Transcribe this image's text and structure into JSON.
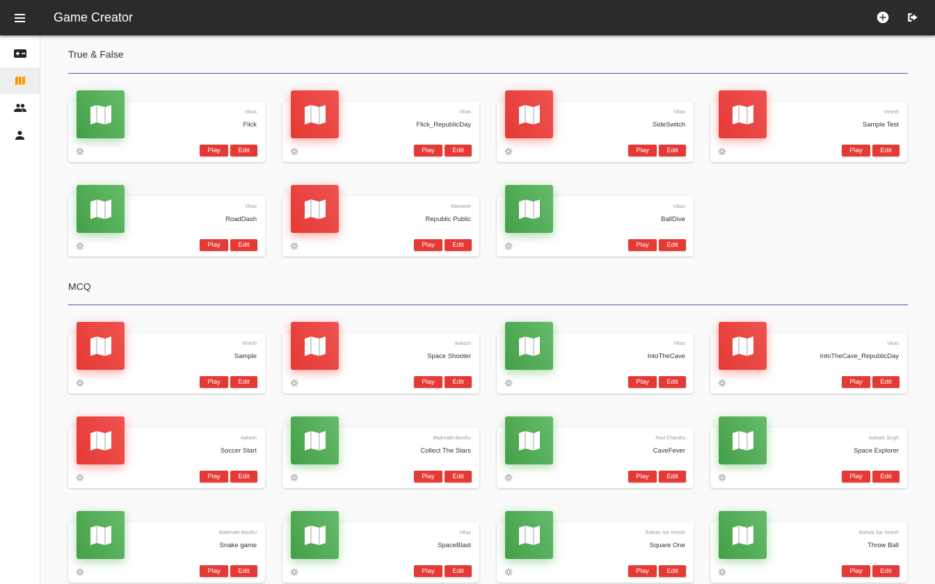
{
  "header": {
    "title": "Game Creator"
  },
  "sections": [
    {
      "title": "True & False",
      "games": [
        {
          "author": "Vikas",
          "name": "Flick",
          "thumb": "green"
        },
        {
          "author": "Vikas",
          "name": "Flick_RepublicDay",
          "thumb": "red"
        },
        {
          "author": "Vikas",
          "name": "SideSwitch",
          "thumb": "red"
        },
        {
          "author": "Vinesh",
          "name": "Sample Test",
          "thumb": "red"
        },
        {
          "author": "Vikas",
          "name": "RoadDash",
          "thumb": "green"
        },
        {
          "author": "Maneesh",
          "name": "Republic Public",
          "thumb": "red"
        },
        {
          "author": "Vikas",
          "name": "BallDive",
          "thumb": "green"
        }
      ]
    },
    {
      "title": "MCQ",
      "games": [
        {
          "author": "Vinesh",
          "name": "Sample",
          "thumb": "red"
        },
        {
          "author": "Aakash",
          "name": "Space Shooter",
          "thumb": "red"
        },
        {
          "author": "Vikas",
          "name": "IntoTheCave",
          "thumb": "green"
        },
        {
          "author": "Vikas",
          "name": "IntoTheCave_RepublicDay",
          "thumb": "red"
        },
        {
          "author": "Aakash",
          "name": "Soccer Start",
          "thumb": "red"
        },
        {
          "author": "Badrinath Bonthu",
          "name": "Collect The Stars",
          "thumb": "green"
        },
        {
          "author": "Ravi Chandra",
          "name": "CaveFever",
          "thumb": "green"
        },
        {
          "author": "Aakash Singh",
          "name": "Space Explorer",
          "thumb": "green"
        },
        {
          "author": "Badrinath Bonthu",
          "name": "Snake game",
          "thumb": "green"
        },
        {
          "author": "Vikas",
          "name": "SpaceBlast",
          "thumb": "green"
        },
        {
          "author": "Battula Sai Vinesh",
          "name": "Square One",
          "thumb": "green"
        },
        {
          "author": "Battula Sai Vinesh",
          "name": "Throw Ball",
          "thumb": "green"
        }
      ]
    }
  ],
  "buttons": {
    "play": "Play",
    "edit": "Edit"
  },
  "sidebar": {
    "items": [
      {
        "icon": "gamepad-icon",
        "active": false
      },
      {
        "icon": "map-icon",
        "active": true
      },
      {
        "icon": "people-icon",
        "active": false
      },
      {
        "icon": "person-icon",
        "active": false
      }
    ]
  },
  "colors": {
    "appbar": "#2b2b2b",
    "accent_red": "#e53935",
    "green": "#4caf50",
    "active_icon": "#ff9800",
    "rule": "#4f57a7"
  }
}
